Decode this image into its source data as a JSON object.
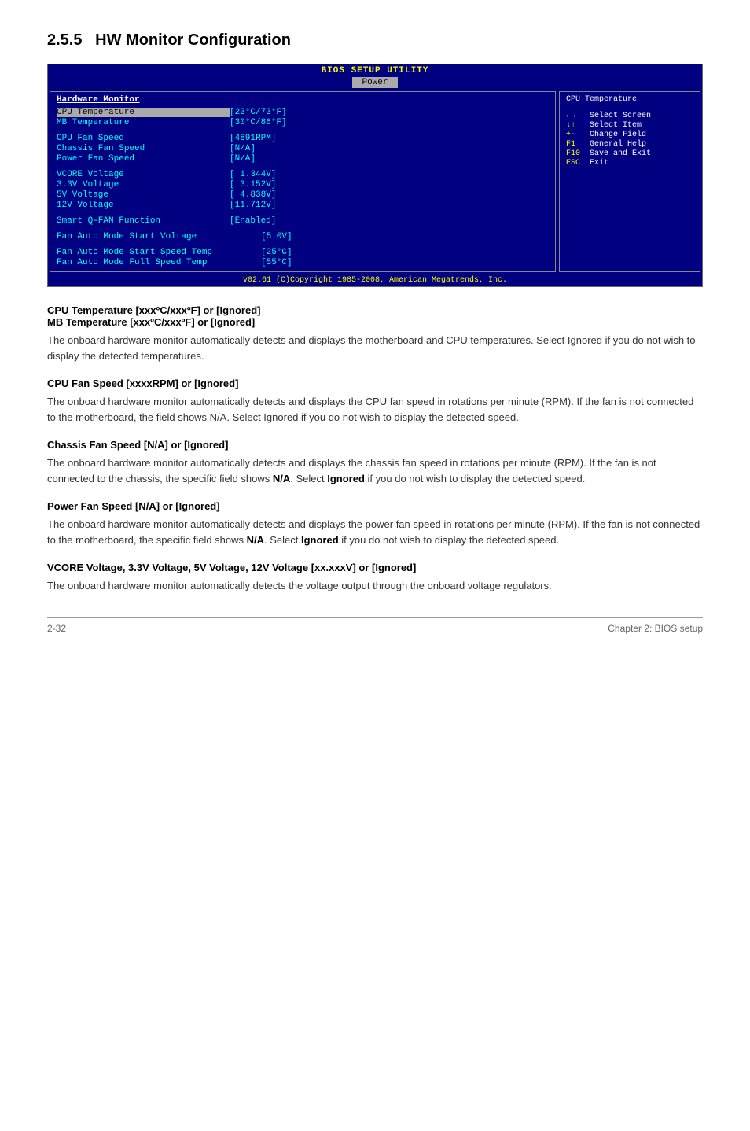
{
  "page": {
    "section_number": "2.5.5",
    "section_title": "HW Monitor Configuration"
  },
  "bios": {
    "title": "BIOS SETUP UTILITY",
    "tab_label": "Power",
    "left_panel": {
      "section_title": "Hardware Monitor",
      "rows": [
        {
          "label": "CPU Temperature",
          "value": "[23°C/73°F]",
          "highlight": true
        },
        {
          "label": "MB Temperature",
          "value": "[30°C/86°F]",
          "highlight": false
        },
        {
          "spacer": true
        },
        {
          "label": "CPU Fan Speed",
          "value": "[4891RPM]",
          "highlight": false
        },
        {
          "label": "Chassis Fan Speed",
          "value": "[N/A]",
          "highlight": false
        },
        {
          "label": "Power Fan Speed",
          "value": "[N/A]",
          "highlight": false
        },
        {
          "spacer": true
        },
        {
          "label": "VCORE Voltage",
          "value": "[ 1.344V]",
          "highlight": false
        },
        {
          "label": "3.3V Voltage",
          "value": "[ 3.152V]",
          "highlight": false
        },
        {
          "label": "5V Voltage",
          "value": "[ 4.838V]",
          "highlight": false
        },
        {
          "label": "12V Voltage",
          "value": "[11.712V]",
          "highlight": false
        },
        {
          "spacer": true
        },
        {
          "label": "Smart Q-FAN Function",
          "value": "[Enabled]",
          "highlight": false
        },
        {
          "spacer": true
        },
        {
          "label": "Fan Auto Mode Start Voltage",
          "value": "[5.0V]",
          "highlight": false
        },
        {
          "spacer": true
        },
        {
          "label": "Fan Auto Mode Start Speed Temp",
          "value": "[25°C]",
          "highlight": false
        },
        {
          "label": "Fan Auto Mode Full Speed Temp",
          "value": "[55°C]",
          "highlight": false
        }
      ]
    },
    "right_panel": {
      "help_title": "CPU Temperature",
      "help_text": ""
    },
    "legend": [
      {
        "key": "←→",
        "desc": "Select Screen"
      },
      {
        "key": "↑↓",
        "desc": "Select Item"
      },
      {
        "key": "+-",
        "desc": "Change Field"
      },
      {
        "key": "F1",
        "desc": "General Help"
      },
      {
        "key": "F10",
        "desc": "Save and Exit"
      },
      {
        "key": "ESC",
        "desc": "Exit"
      }
    ],
    "footer": "v02.61 (C)Copyright 1985-2008, American Megatrends, Inc."
  },
  "sections": [
    {
      "heading": "CPU Temperature [xxxºC/xxxºF] or [Ignored]\nMB Temperature [xxxºC/xxxºF] or [Ignored]",
      "body": "The onboard hardware monitor automatically detects and displays the motherboard and CPU temperatures. Select Ignored if you do not wish to display the detected temperatures."
    },
    {
      "heading": "CPU Fan Speed [xxxxRPM] or [Ignored]",
      "body": "The onboard hardware monitor automatically detects and displays the CPU fan speed in rotations per minute (RPM). If the fan is not connected to the motherboard, the field shows N/A. Select Ignored if you do not wish to display the detected speed."
    },
    {
      "heading": "Chassis Fan Speed [N/A] or [Ignored]",
      "body_parts": [
        {
          "text": "The onboard hardware monitor automatically detects and displays the chassis fan speed in rotations per minute (RPM). If the fan is not connected to the chassis, the specific field shows "
        },
        {
          "text": "N/A",
          "bold": true
        },
        {
          "text": ". Select "
        },
        {
          "text": "Ignored",
          "bold": true
        },
        {
          "text": " if you do not wish to display the detected speed."
        }
      ]
    },
    {
      "heading": "Power Fan Speed [N/A] or [Ignored]",
      "body_parts": [
        {
          "text": "The onboard hardware monitor automatically detects and displays the power fan speed in rotations per minute (RPM). If the fan is not connected to the motherboard, the specific field shows "
        },
        {
          "text": "N/A",
          "bold": true
        },
        {
          "text": ". Select "
        },
        {
          "text": "Ignored",
          "bold": true
        },
        {
          "text": " if you do not wish to display the detected speed."
        }
      ]
    },
    {
      "heading": "VCORE Voltage, 3.3V Voltage, 5V Voltage, 12V Voltage [xx.xxxV] or [Ignored]",
      "body": "The onboard hardware monitor automatically detects the voltage output through the onboard voltage regulators."
    }
  ],
  "footer": {
    "page_number": "2-32",
    "chapter": "Chapter 2: BIOS setup"
  }
}
